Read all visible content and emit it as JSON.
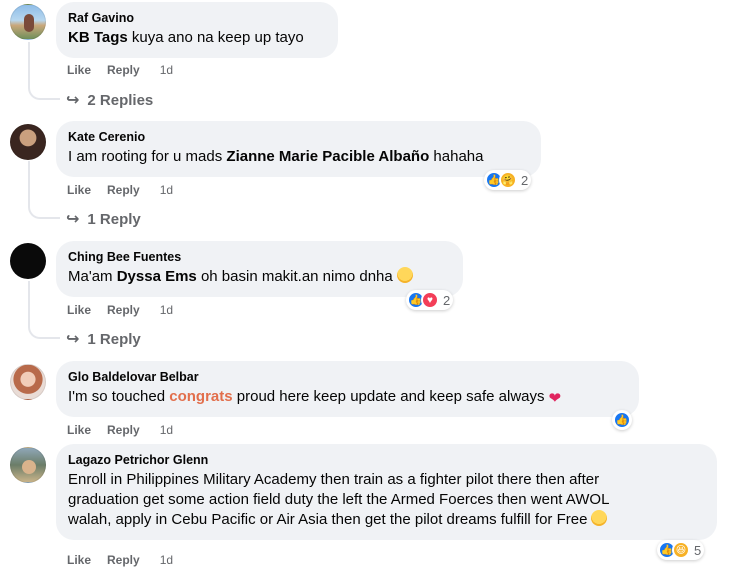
{
  "comments": [
    {
      "author": "Raf Gavino",
      "text_parts": [
        "KB Tags",
        " kuya ano na keep up tayo"
      ],
      "like": "Like",
      "reply": "Reply",
      "time": "1d",
      "replies": "2 Replies"
    },
    {
      "author": "Kate Cerenio",
      "text_parts": [
        "I am rooting for u mads ",
        "Zianne Marie Pacible Albaño",
        " hahaha"
      ],
      "like": "Like",
      "reply": "Reply",
      "time": "1d",
      "replies": "1 Reply",
      "reaction_count": "2"
    },
    {
      "author": "Ching Bee Fuentes",
      "text_parts": [
        "Ma'am ",
        "Dyssa Ems",
        " oh basin makit.an nimo dnha"
      ],
      "like": "Like",
      "reply": "Reply",
      "time": "1d",
      "replies": "1 Reply",
      "reaction_count": "2"
    },
    {
      "author": "Glo Baldelovar Belbar",
      "text_parts": [
        "I'm so touched ",
        "congrats",
        " proud here keep update and keep safe always"
      ],
      "like": "Like",
      "reply": "Reply",
      "time": "1d"
    },
    {
      "author": "Lagazo Petrichor Glenn",
      "text_lines": [
        "Enroll in Philippines Military Academy then train as a fighter pilot there then after",
        "graduation get some action field duty the left the Armed Foerces then went AWOL",
        "walah, apply in Cebu Pacific or Air Asia then get the pilot dreams fulfill for Free"
      ],
      "like": "Like",
      "reply": "Reply",
      "time": "1d",
      "reaction_count": "5"
    }
  ],
  "icons": {
    "reply_arrow": "reply-arrow-icon",
    "like": "like-reaction-icon",
    "love": "love-reaction-icon",
    "care": "care-reaction-icon",
    "haha": "haha-reaction-icon"
  },
  "colors": {
    "bubble": "#f0f2f5",
    "secondary_text": "#65676b",
    "mention_highlight": "#e26f4c",
    "like_blue": "#1877f2",
    "love_red": "#f33e58",
    "haha_yellow": "#f7b125"
  }
}
